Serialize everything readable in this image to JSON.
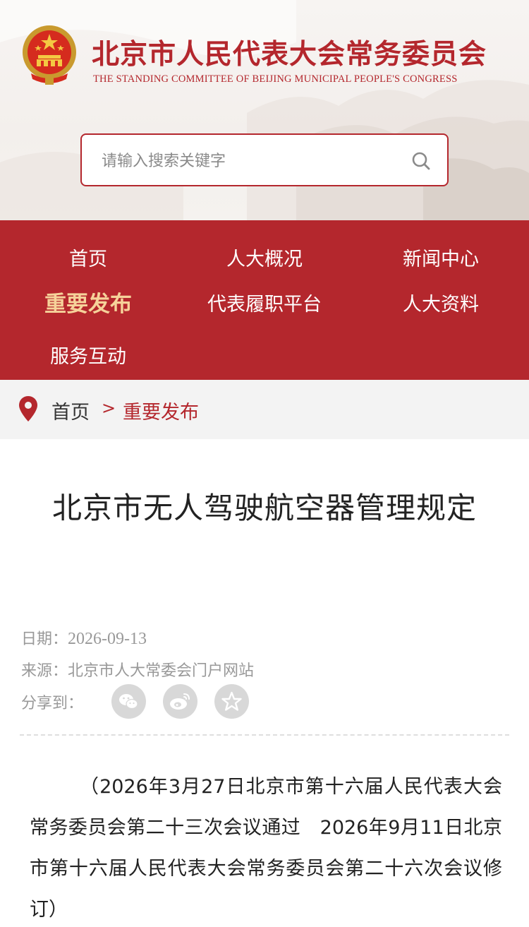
{
  "header": {
    "site_title": "北京市人民代表大会常务委员会",
    "site_subtitle": "THE STANDING COMMITTEE OF BEIJING MUNICIPAL PEOPLE'S CONGRESS",
    "emblem_icon": "national-emblem-icon"
  },
  "search": {
    "placeholder": "请输入搜索关键字",
    "value": "",
    "icon": "search-icon"
  },
  "nav": {
    "items": [
      {
        "label": "首页",
        "active": false
      },
      {
        "label": "人大概况",
        "active": false
      },
      {
        "label": "新闻中心",
        "active": false
      },
      {
        "label": "重要发布",
        "active": true
      },
      {
        "label": "代表履职平台",
        "active": false
      },
      {
        "label": "人大资料",
        "active": false
      },
      {
        "label": "服务互动",
        "active": false
      }
    ]
  },
  "breadcrumb": {
    "home": "首页",
    "separator": ">",
    "current": "重要发布",
    "icon": "location-pin-icon"
  },
  "article": {
    "title": "北京市无人驾驶航空器管理规定",
    "date_label": "日期：",
    "date": "2026-09-13",
    "source_label": "来源：",
    "source": "北京市人大常委会门户网站",
    "share_label": "分享到：",
    "share_icons": [
      "wechat-icon",
      "weibo-icon",
      "favorite-star-icon"
    ],
    "note": "（2026年3月27日北京市第十六届人民代表大会常务委员会第二十三次会议通过　2026年9月11日北京市第十六届人民代表大会常务委员会第二十六次会议修订）"
  },
  "colors": {
    "brand_red": "#b4272d",
    "nav_active": "#f6d29a",
    "muted_text": "#999999",
    "breadcrumb_bg": "#f3f3f3"
  }
}
